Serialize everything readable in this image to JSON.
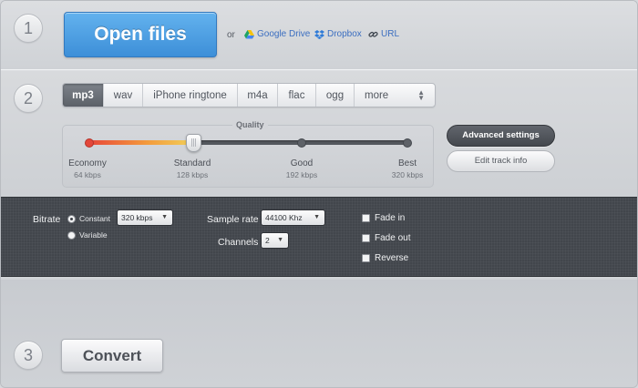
{
  "steps": {
    "one": "1",
    "two": "2",
    "three": "3"
  },
  "open": {
    "button_label": "Open files",
    "or_text": "or",
    "sources": {
      "google_drive": "Google Drive",
      "dropbox": "Dropbox",
      "url": "URL"
    }
  },
  "format_tabs": {
    "items": [
      "mp3",
      "wav",
      "iPhone ringtone",
      "m4a",
      "flac",
      "ogg",
      "more"
    ],
    "selected": "mp3"
  },
  "quality": {
    "label": "Quality",
    "levels": [
      {
        "name": "Economy",
        "rate": "64 kbps"
      },
      {
        "name": "Standard",
        "rate": "128 kbps"
      },
      {
        "name": "Good",
        "rate": "192 kbps"
      },
      {
        "name": "Best",
        "rate": "320 kbps"
      }
    ],
    "selected_level": "Standard"
  },
  "settings_buttons": {
    "advanced": "Advanced settings",
    "edit_track": "Edit track info"
  },
  "advanced": {
    "bitrate_label": "Bitrate",
    "constant_label": "Constant",
    "variable_label": "Variable",
    "bitrate_mode": "Constant",
    "bitrate_value": "320 kbps",
    "sample_rate_label": "Sample rate",
    "sample_rate_value": "44100 Khz",
    "channels_label": "Channels",
    "channels_value": "2",
    "fade_in_label": "Fade in",
    "fade_out_label": "Fade out",
    "reverse_label": "Reverse"
  },
  "convert": {
    "button_label": "Convert"
  },
  "colors": {
    "open_button": "#4a9de2",
    "link": "#3b6ec0",
    "active_tab": "#6b7077",
    "panel_bg": "#42464c",
    "quality_gradient_start": "#e8463a",
    "quality_gradient_end": "#f1d15a"
  }
}
